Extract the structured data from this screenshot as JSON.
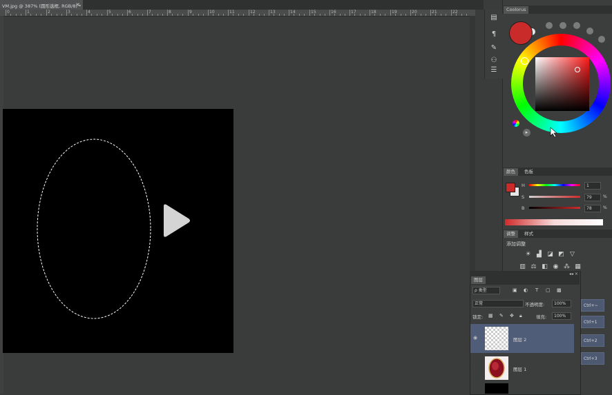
{
  "document": {
    "tab_title": "VM.jpg @ 387% (圆形选框, RGB/8) *",
    "close_glyph": "×"
  },
  "ruler": {
    "labels": [
      "0",
      "1",
      "2",
      "3",
      "4",
      "5",
      "6",
      "7",
      "8",
      "9",
      "10",
      "11",
      "12",
      "13",
      "14",
      "15",
      "16",
      "17",
      "18",
      "19",
      "20",
      "21",
      "22"
    ]
  },
  "canvas": {
    "background": "#000000",
    "selection": "elliptical marquee (marching ants)"
  },
  "video": {
    "play_icon": "play-icon"
  },
  "toolstrip": {
    "icons": [
      "layer-comps-icon",
      "paragraph-icon",
      "brush-presets-icon",
      "clone-source-icon",
      "properties-icon"
    ]
  },
  "coolorus": {
    "tab_label": "Coolorus",
    "foreground_color": "#c92a2a",
    "background_color": "#e6e6e6"
  },
  "color_panel": {
    "tabs": [
      "颜色",
      "色板"
    ],
    "sliders": [
      {
        "label": "H",
        "value": "1",
        "unit": ""
      },
      {
        "label": "S",
        "value": "79",
        "unit": "%"
      },
      {
        "label": "B",
        "value": "78",
        "unit": "%"
      }
    ]
  },
  "adjustments_panel": {
    "tabs": [
      "调整",
      "样式"
    ],
    "title": "添加调整"
  },
  "layers_panel": {
    "tab_label": "图层",
    "kind_label": "ρ 类型",
    "blend_mode": "正常",
    "opacity_label": "不透明度:",
    "opacity_value": "100%",
    "lock_label": "锁定:",
    "fill_label": "填充:",
    "fill_value": "100%",
    "layers": [
      {
        "name": "图层 2",
        "selected": true
      },
      {
        "name": "图层 1",
        "selected": false
      }
    ]
  },
  "shortcut_buttons": [
    "Ctrl+~",
    "Ctrl+1",
    "Ctrl+2",
    "Ctrl+3"
  ]
}
